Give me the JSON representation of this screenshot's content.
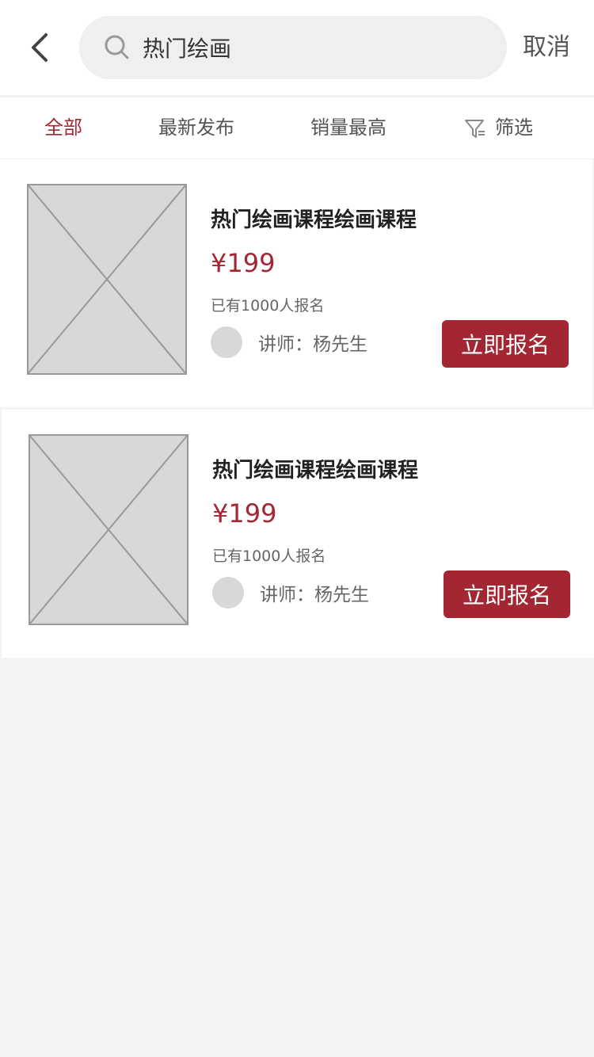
{
  "header": {
    "search": {
      "value": "热门绘画",
      "icon": "search-icon"
    },
    "cancel_label": "取消"
  },
  "tabs": [
    {
      "label": "全部",
      "active": true
    },
    {
      "label": "最新发布",
      "active": false
    },
    {
      "label": "销量最高",
      "active": false
    },
    {
      "label": "筛选",
      "active": false,
      "icon": "filter-icon"
    }
  ],
  "colors": {
    "accent": "#a32733",
    "background": "#f3f4f3",
    "placeholder": "#d8d8d8"
  },
  "courses": [
    {
      "title": "热门绘画课程绘画课程",
      "price": "¥199",
      "enrolled": "已有1000人报名",
      "teacher_label": "讲师：",
      "teacher_name": "杨先生",
      "button_label": "立即报名"
    },
    {
      "title": "热门绘画课程绘画课程",
      "price": "¥199",
      "enrolled": "已有1000人报名",
      "teacher_label": "讲师：",
      "teacher_name": "杨先生",
      "button_label": "立即报名"
    }
  ]
}
